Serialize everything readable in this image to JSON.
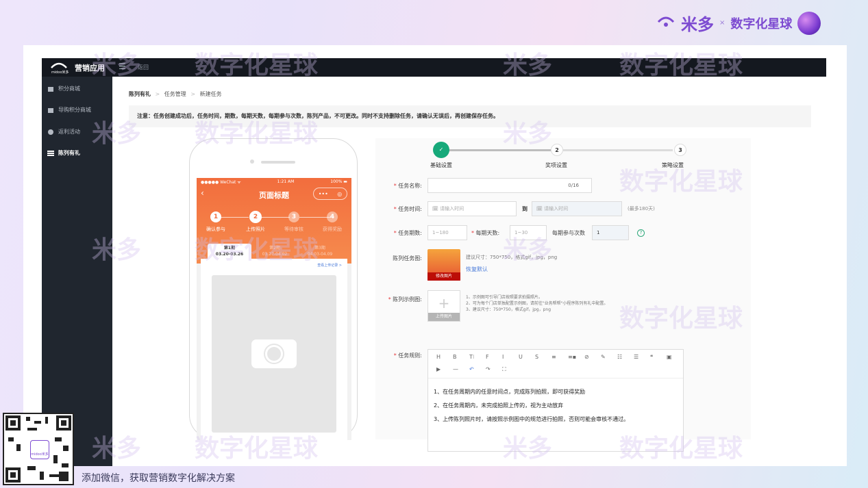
{
  "brand": {
    "name": "米多",
    "separator": "×",
    "partner": "数字化星球"
  },
  "topbar": {
    "logo_text": "midoo米多",
    "app_title": "营销应用",
    "menu_icon": "☰",
    "back_label": "返回"
  },
  "sidebar": {
    "items": [
      {
        "label": "积分商城",
        "icon": "store-icon"
      },
      {
        "label": "导购积分商城",
        "icon": "store-icon"
      },
      {
        "label": "返利活动",
        "icon": "coin-icon"
      },
      {
        "label": "陈列有礼",
        "icon": "list-icon"
      }
    ]
  },
  "breadcrumb": {
    "root": "陈列有礼",
    "sep": ">",
    "mid": "任务管理",
    "current": "新建任务"
  },
  "notice": "注意：任务创建成功后，任务时间，期数，每期天数，每期参与次数，陈列产品，不可更改。同时不支持删除任务，请确认无误后，再创建保存任务。",
  "phone": {
    "status": {
      "left": "●●●●● WeChat ᯤ",
      "center": "1:21 AM",
      "right": "100% ▬"
    },
    "nav_title": "页面标题",
    "capsule": {
      "more": "•••",
      "close": "◎"
    },
    "steps": [
      {
        "num": "1",
        "label": "确认参与",
        "active": true
      },
      {
        "num": "2",
        "label": "上传照片",
        "active": true
      },
      {
        "num": "3",
        "label": "等待审核",
        "active": false
      },
      {
        "num": "4",
        "label": "获得奖励",
        "active": false
      }
    ],
    "periods": [
      {
        "name": "第1期",
        "range": "03.20-03.26"
      },
      {
        "name": "第2期",
        "range": "03.27-04.02"
      },
      {
        "name": "第3期",
        "range": "04.03-04.09"
      }
    ],
    "view_upload_link": "查看上传记录 >"
  },
  "stepper": {
    "steps": [
      {
        "num": "✓",
        "label": "基础设置"
      },
      {
        "num": "2",
        "label": "奖项设置"
      },
      {
        "num": "3",
        "label": "策略设置"
      }
    ]
  },
  "form": {
    "task_name": {
      "label": "任务名称:",
      "counter": "0/16"
    },
    "task_time": {
      "label": "任务时间:",
      "start_placeholder": "请输入时间",
      "to": "到",
      "end_placeholder": "请输入时间",
      "note": "(最多180天)"
    },
    "task_periods": {
      "label": "任务期数:",
      "placeholder": "1~180"
    },
    "days_per_period": {
      "label": "每期天数:",
      "placeholder": "1~30"
    },
    "times_per_period": {
      "label": "每期参与次数",
      "value": "1",
      "help": "?"
    },
    "task_image": {
      "label": "陈列任务图:",
      "thumb_label": "修改图片",
      "hint": "建议尺寸：750*750，格式gif，jpg，png",
      "restore": "恢复默认"
    },
    "example_image": {
      "label": "陈列示例图:",
      "upload_label": "上传图片",
      "hints": [
        "1、示例图可引导门店按照要求拍摄照片。",
        "2、可为每个门店单独配置示例图，请前往\"业务帮帮\"小程序陈列有礼中配置。",
        "3、建议尺寸：750*750，格式gif，jpg，png"
      ]
    },
    "rules": {
      "label": "任务规则:",
      "toolbar_row1": [
        "H",
        "B",
        "T⁝",
        "F",
        "I",
        "U",
        "S",
        "≡",
        "≡▪",
        "⊘",
        "✎",
        "☷",
        "☰",
        "❝",
        "▣"
      ],
      "toolbar_row2": [
        "▶",
        "—",
        "↶",
        "↷",
        "⛶"
      ],
      "lines": [
        "1、在任务周期内的任意时间点，完成陈列拍照，即可获得奖励",
        "2、在任务周期内，未完成拍照上传的，视为主动放弃",
        "3、上传陈列照片时，请按照示例图中的规范进行拍照，否则可能会审核不通过。"
      ]
    }
  },
  "watermark": {
    "brand": "米多",
    "partner": "数字化星球",
    "x": "x",
    "logo": "midoo"
  },
  "qr": {
    "logo_text": "midoo米多"
  },
  "footer": {
    "text": "添加微信，获取营销数字化解决方案"
  },
  "colors": {
    "accent": "#17a97a",
    "orange": "#f26d3d",
    "brand": "#7d4bd1",
    "sidebar": "#20262f"
  }
}
